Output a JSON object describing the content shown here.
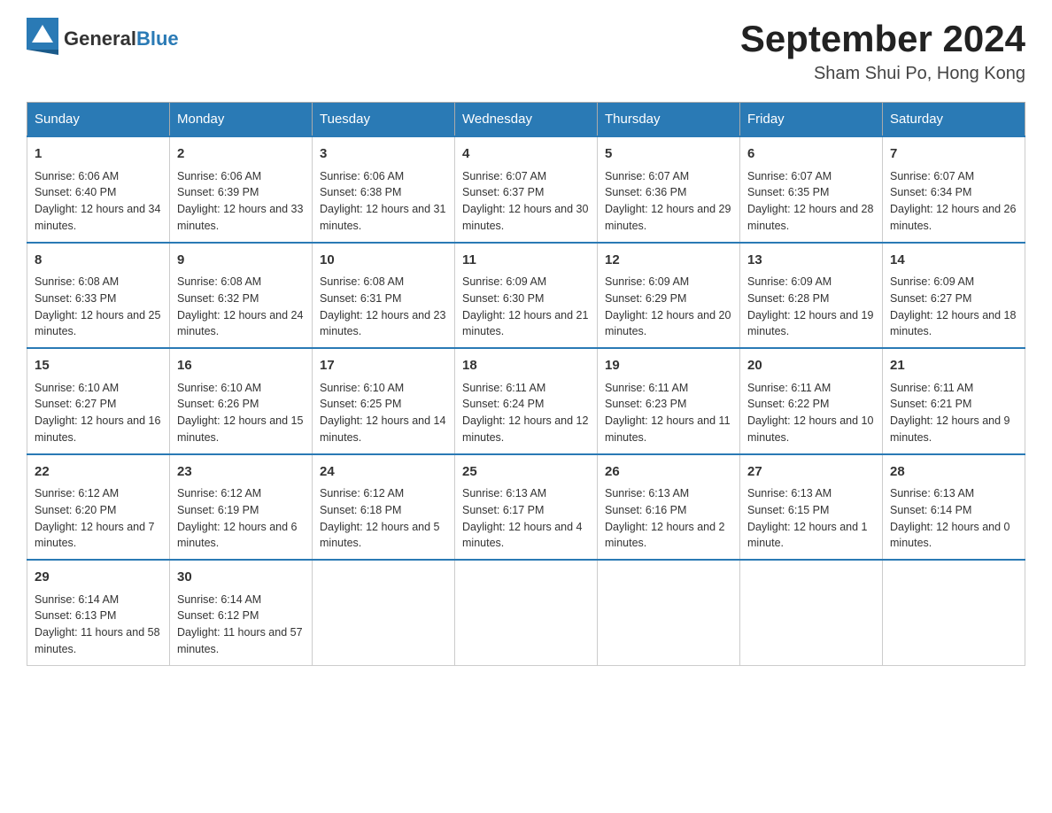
{
  "header": {
    "logo": {
      "general": "General",
      "blue": "Blue"
    },
    "title": "September 2024",
    "location": "Sham Shui Po, Hong Kong"
  },
  "days": [
    "Sunday",
    "Monday",
    "Tuesday",
    "Wednesday",
    "Thursday",
    "Friday",
    "Saturday"
  ],
  "weeks": [
    [
      {
        "num": "1",
        "sunrise": "6:06 AM",
        "sunset": "6:40 PM",
        "daylight": "12 hours and 34 minutes."
      },
      {
        "num": "2",
        "sunrise": "6:06 AM",
        "sunset": "6:39 PM",
        "daylight": "12 hours and 33 minutes."
      },
      {
        "num": "3",
        "sunrise": "6:06 AM",
        "sunset": "6:38 PM",
        "daylight": "12 hours and 31 minutes."
      },
      {
        "num": "4",
        "sunrise": "6:07 AM",
        "sunset": "6:37 PM",
        "daylight": "12 hours and 30 minutes."
      },
      {
        "num": "5",
        "sunrise": "6:07 AM",
        "sunset": "6:36 PM",
        "daylight": "12 hours and 29 minutes."
      },
      {
        "num": "6",
        "sunrise": "6:07 AM",
        "sunset": "6:35 PM",
        "daylight": "12 hours and 28 minutes."
      },
      {
        "num": "7",
        "sunrise": "6:07 AM",
        "sunset": "6:34 PM",
        "daylight": "12 hours and 26 minutes."
      }
    ],
    [
      {
        "num": "8",
        "sunrise": "6:08 AM",
        "sunset": "6:33 PM",
        "daylight": "12 hours and 25 minutes."
      },
      {
        "num": "9",
        "sunrise": "6:08 AM",
        "sunset": "6:32 PM",
        "daylight": "12 hours and 24 minutes."
      },
      {
        "num": "10",
        "sunrise": "6:08 AM",
        "sunset": "6:31 PM",
        "daylight": "12 hours and 23 minutes."
      },
      {
        "num": "11",
        "sunrise": "6:09 AM",
        "sunset": "6:30 PM",
        "daylight": "12 hours and 21 minutes."
      },
      {
        "num": "12",
        "sunrise": "6:09 AM",
        "sunset": "6:29 PM",
        "daylight": "12 hours and 20 minutes."
      },
      {
        "num": "13",
        "sunrise": "6:09 AM",
        "sunset": "6:28 PM",
        "daylight": "12 hours and 19 minutes."
      },
      {
        "num": "14",
        "sunrise": "6:09 AM",
        "sunset": "6:27 PM",
        "daylight": "12 hours and 18 minutes."
      }
    ],
    [
      {
        "num": "15",
        "sunrise": "6:10 AM",
        "sunset": "6:27 PM",
        "daylight": "12 hours and 16 minutes."
      },
      {
        "num": "16",
        "sunrise": "6:10 AM",
        "sunset": "6:26 PM",
        "daylight": "12 hours and 15 minutes."
      },
      {
        "num": "17",
        "sunrise": "6:10 AM",
        "sunset": "6:25 PM",
        "daylight": "12 hours and 14 minutes."
      },
      {
        "num": "18",
        "sunrise": "6:11 AM",
        "sunset": "6:24 PM",
        "daylight": "12 hours and 12 minutes."
      },
      {
        "num": "19",
        "sunrise": "6:11 AM",
        "sunset": "6:23 PM",
        "daylight": "12 hours and 11 minutes."
      },
      {
        "num": "20",
        "sunrise": "6:11 AM",
        "sunset": "6:22 PM",
        "daylight": "12 hours and 10 minutes."
      },
      {
        "num": "21",
        "sunrise": "6:11 AM",
        "sunset": "6:21 PM",
        "daylight": "12 hours and 9 minutes."
      }
    ],
    [
      {
        "num": "22",
        "sunrise": "6:12 AM",
        "sunset": "6:20 PM",
        "daylight": "12 hours and 7 minutes."
      },
      {
        "num": "23",
        "sunrise": "6:12 AM",
        "sunset": "6:19 PM",
        "daylight": "12 hours and 6 minutes."
      },
      {
        "num": "24",
        "sunrise": "6:12 AM",
        "sunset": "6:18 PM",
        "daylight": "12 hours and 5 minutes."
      },
      {
        "num": "25",
        "sunrise": "6:13 AM",
        "sunset": "6:17 PM",
        "daylight": "12 hours and 4 minutes."
      },
      {
        "num": "26",
        "sunrise": "6:13 AM",
        "sunset": "6:16 PM",
        "daylight": "12 hours and 2 minutes."
      },
      {
        "num": "27",
        "sunrise": "6:13 AM",
        "sunset": "6:15 PM",
        "daylight": "12 hours and 1 minute."
      },
      {
        "num": "28",
        "sunrise": "6:13 AM",
        "sunset": "6:14 PM",
        "daylight": "12 hours and 0 minutes."
      }
    ],
    [
      {
        "num": "29",
        "sunrise": "6:14 AM",
        "sunset": "6:13 PM",
        "daylight": "11 hours and 58 minutes."
      },
      {
        "num": "30",
        "sunrise": "6:14 AM",
        "sunset": "6:12 PM",
        "daylight": "11 hours and 57 minutes."
      },
      null,
      null,
      null,
      null,
      null
    ]
  ]
}
